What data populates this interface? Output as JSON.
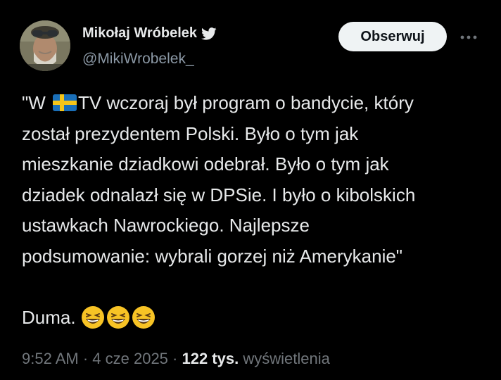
{
  "author": {
    "display_name": "Mikołaj Wróbelek",
    "handle": "@MikiWrobelek_",
    "verified_icon": "twitter-bird-icon",
    "avatar_icon": "avatar-photo"
  },
  "actions": {
    "follow_label": "Obserwuj",
    "more_icon": "more-horizontal-icon"
  },
  "tweet": {
    "line1_before_flag": "\"W ",
    "flag_icon": "sweden-flag-icon",
    "line1_after_flag": "TV wczoraj był program o bandycie, który",
    "line2": "został prezydentem Polski. Było o tym jak",
    "line3": "mieszkanie dziadkowi odebrał. Było o tym jak",
    "line4": "dziadek odnalazł się w DPSie. I było o kibolskich",
    "line5": "ustawkach Nawrockiego. Najlepsze",
    "line6": "podsumowanie:  wybrali gorzej niż Amerykanie\"",
    "line8": "Duma. ",
    "emoji_icon": "grinning-squinting-face-emoji"
  },
  "meta": {
    "time": "9:52 AM",
    "separator": " · ",
    "date": "4 cze 2025",
    "views_count": "122 tys.",
    "views_label": " wyświetlenia"
  },
  "colors": {
    "background": "#000000",
    "text_primary": "#e7e9ea",
    "text_secondary": "#71767b",
    "handle": "#8b98a5",
    "follow_button_bg": "#eff3f4",
    "twitter_blue": "#1d9bf0"
  }
}
